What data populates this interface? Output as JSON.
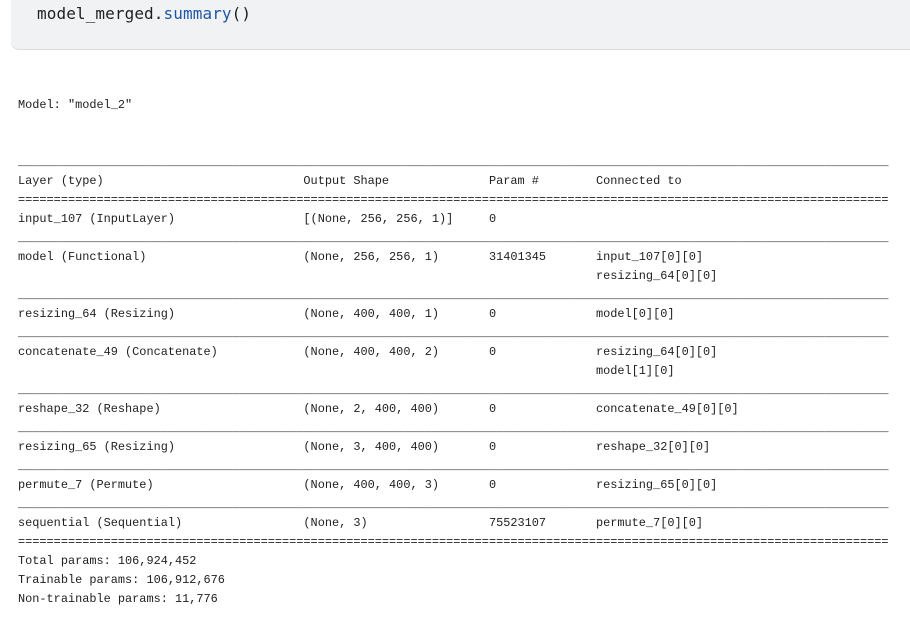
{
  "code_cell": {
    "object": "model_merged",
    "dot": ".",
    "method": "summary",
    "parens": "()"
  },
  "summary": {
    "model_title": "Model: \"model_2\"",
    "columns": [
      "Layer (type)",
      "Output Shape",
      "Param #",
      "Connected to"
    ],
    "rows": [
      {
        "layer": "input_107 (InputLayer)",
        "shape": "[(None, 256, 256, 1)]",
        "params": "0",
        "connected": []
      },
      {
        "layer": "model (Functional)",
        "shape": "(None, 256, 256, 1)",
        "params": "31401345",
        "connected": [
          "input_107[0][0]",
          "resizing_64[0][0]"
        ]
      },
      {
        "layer": "resizing_64 (Resizing)",
        "shape": "(None, 400, 400, 1)",
        "params": "0",
        "connected": [
          "model[0][0]"
        ]
      },
      {
        "layer": "concatenate_49 (Concatenate)",
        "shape": "(None, 400, 400, 2)",
        "params": "0",
        "connected": [
          "resizing_64[0][0]",
          "model[1][0]"
        ]
      },
      {
        "layer": "reshape_32 (Reshape)",
        "shape": "(None, 2, 400, 400)",
        "params": "0",
        "connected": [
          "concatenate_49[0][0]"
        ]
      },
      {
        "layer": "resizing_65 (Resizing)",
        "shape": "(None, 3, 400, 400)",
        "params": "0",
        "connected": [
          "reshape_32[0][0]"
        ]
      },
      {
        "layer": "permute_7 (Permute)",
        "shape": "(None, 400, 400, 3)",
        "params": "0",
        "connected": [
          "resizing_65[0][0]"
        ]
      },
      {
        "layer": "sequential (Sequential)",
        "shape": "(None, 3)",
        "params": "75523107",
        "connected": [
          "permute_7[0][0]"
        ]
      }
    ],
    "totals": {
      "total": "Total params: 106,924,452",
      "trainable": "Trainable params: 106,912,676",
      "non_trainable": "Non-trainable params: 11,776"
    }
  }
}
